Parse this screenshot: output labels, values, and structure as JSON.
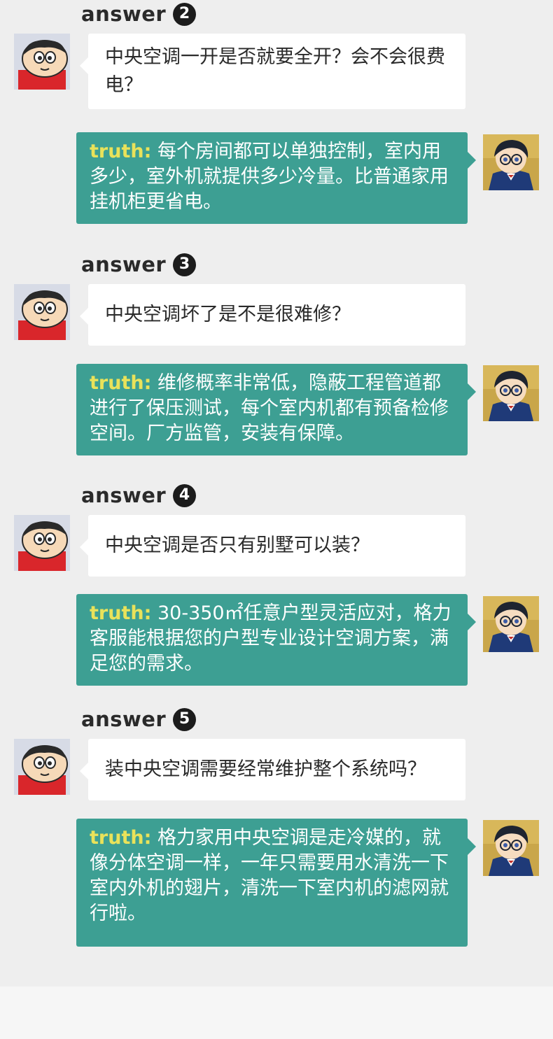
{
  "sections": [
    {
      "label": "answer",
      "number": "2",
      "question": "中央空调一开是否就要全开？会不会很费电？",
      "truth_prefix": "truth:",
      "truth_text": "每个房间都可以单独控制，室内用多少，室外机就提供多少冷量。比普通家用挂机柜更省电。"
    },
    {
      "label": "answer",
      "number": "3",
      "question": "中央空调坏了是不是很难修？",
      "truth_prefix": "truth:",
      "truth_text": "维修概率非常低，隐蔽工程管道都进行了保压测试，每个室内机都有预备检修空间。厂方监管，安装有保障。"
    },
    {
      "label": "answer",
      "number": "4",
      "question": "中央空调是否只有别墅可以装？",
      "truth_prefix": "truth:",
      "truth_text": "30-350㎡任意户型灵活应对，格力客服能根据您的户型专业设计空调方案，满足您的需求。"
    },
    {
      "label": "answer",
      "number": "5",
      "question": "装中央空调需要经常维护整个系统吗？",
      "truth_prefix": "truth:",
      "truth_text": "格力家用中央空调是走冷媒的，就像分体空调一样，一年只需要用水清洗一下室内外机的翅片，清洗一下室内机的滤网就行啦。"
    }
  ],
  "colors": {
    "background": "#eeeeee",
    "question_bubble": "#ffffff",
    "truth_bubble": "#3d9f93",
    "truth_prefix": "#e9e25a",
    "text_dark": "#2a2a2a"
  },
  "icons": {
    "asker_avatar": "cartoon-boy-avatar-icon",
    "answerer_avatar": "detective-boy-avatar-icon"
  }
}
